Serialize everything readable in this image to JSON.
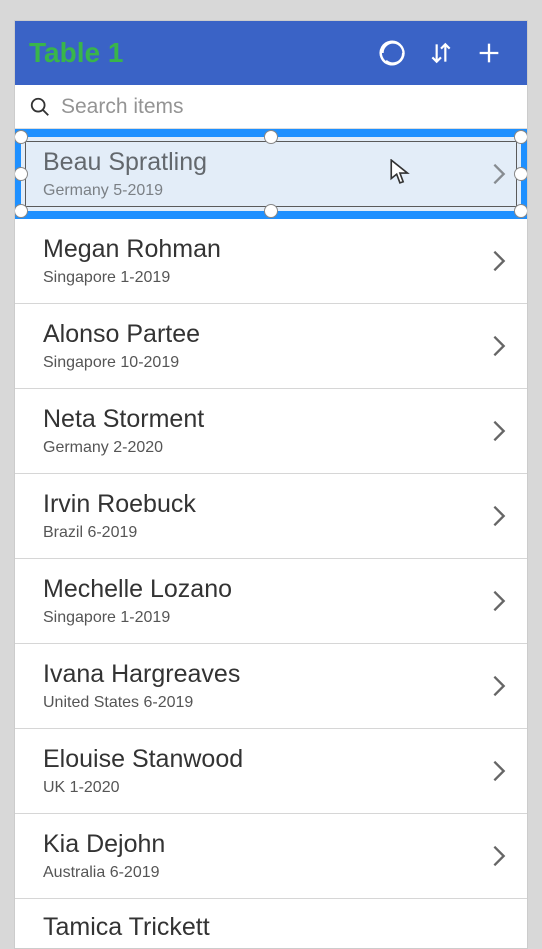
{
  "header": {
    "title": "Table 1"
  },
  "search": {
    "placeholder": "Search items"
  },
  "items": [
    {
      "name": "Beau Spratling",
      "sub": "Germany 5-2019"
    },
    {
      "name": "Megan Rohman",
      "sub": "Singapore 1-2019"
    },
    {
      "name": "Alonso Partee",
      "sub": "Singapore 10-2019"
    },
    {
      "name": "Neta Storment",
      "sub": "Germany 2-2020"
    },
    {
      "name": "Irvin Roebuck",
      "sub": "Brazil 6-2019"
    },
    {
      "name": "Mechelle Lozano",
      "sub": "Singapore 1-2019"
    },
    {
      "name": "Ivana Hargreaves",
      "sub": "United States 6-2019"
    },
    {
      "name": "Elouise Stanwood",
      "sub": "UK 1-2020"
    },
    {
      "name": "Kia Dejohn",
      "sub": "Australia 6-2019"
    },
    {
      "name": "Tamica Trickett",
      "sub": ""
    }
  ]
}
